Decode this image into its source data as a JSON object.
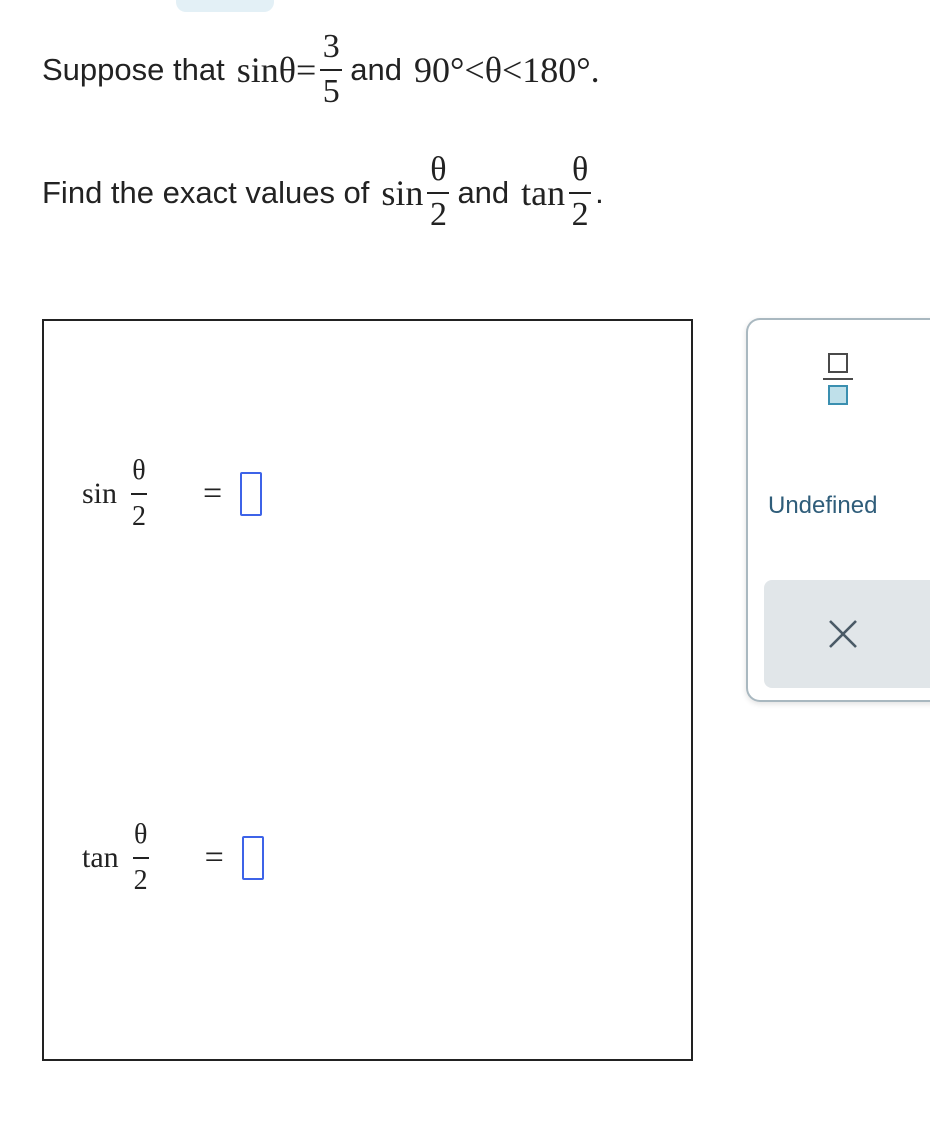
{
  "problem": {
    "line1": {
      "prefix": "Suppose that",
      "func": "sinθ=",
      "num": "3",
      "den": "5",
      "mid": "and",
      "condition": "90°<θ<180°."
    },
    "line2": {
      "prefix": "Find the exact values of",
      "func1": "sin",
      "num1": "θ",
      "den1": "2",
      "mid": "and",
      "func2": "tan",
      "num2": "θ",
      "den2": "2",
      "end": "."
    }
  },
  "answers": [
    {
      "func": "sin",
      "num": "θ",
      "den": "2",
      "eq": "=",
      "value": ""
    },
    {
      "func": "tan",
      "num": "θ",
      "den": "2",
      "eq": "=",
      "value": ""
    }
  ],
  "palette": {
    "fraction_icon": "fraction-template-icon",
    "undefined_label": "Undefined",
    "clear_icon": "close-icon"
  },
  "colors": {
    "input_border": "#3d63e8",
    "undefined_text": "#2f5d7a",
    "clear_bg": "#e1e6e9"
  }
}
